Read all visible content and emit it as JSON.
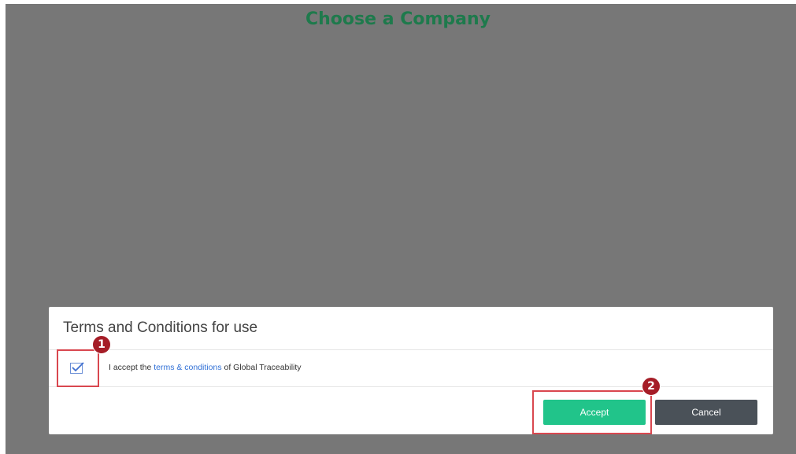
{
  "page": {
    "title": "Choose a Company"
  },
  "dialog": {
    "title": "Terms and Conditions for use",
    "checkbox_checked": true,
    "accept_prefix": "I accept the ",
    "terms_link": "terms & conditions",
    "accept_suffix": " of Global Traceability",
    "accept_button": "Accept",
    "cancel_button": "Cancel"
  },
  "annotations": {
    "step_1": "1",
    "step_2": "2"
  },
  "colors": {
    "backdrop": "#777777",
    "page_title": "#1e7a4c",
    "accept_button": "#21c48a",
    "cancel_button": "#4a5158",
    "link": "#2f6fd6",
    "highlight": "#d9474f",
    "marker": "#a51d27"
  }
}
